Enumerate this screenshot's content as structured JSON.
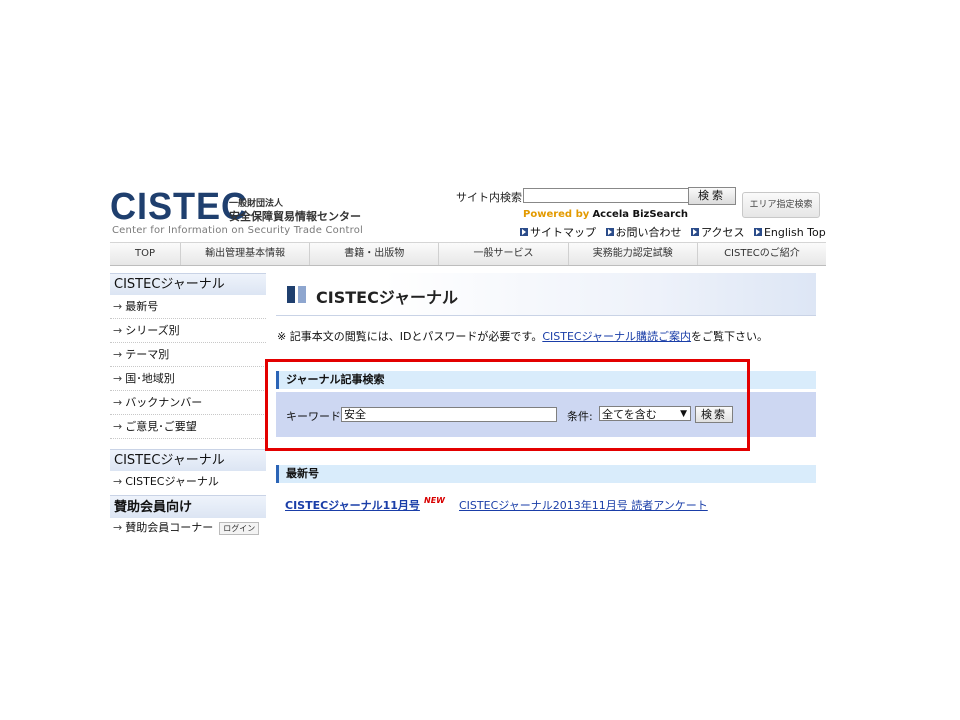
{
  "header": {
    "logo_text": "CISTEC",
    "org_line1": "一般財団法人",
    "org_line2": "安全保障貿易情報センター",
    "tagline": "Center for Information on Security Trade Control",
    "site_search_label": "サイト内検索",
    "site_search_value": "",
    "site_search_button": "検索",
    "area_search_button": "エリア指定検索",
    "powered_by": "Powered by",
    "powered_name": "Accela BizSearch",
    "util_links": [
      "サイトマップ",
      "お問い合わせ",
      "アクセス",
      "English Top"
    ]
  },
  "nav": [
    "TOP",
    "輸出管理基本情報",
    "書籍・出版物",
    "一般サービス",
    "実務能力認定試験",
    "CISTECのご紹介"
  ],
  "sidebar": {
    "journal_title": "CISTECジャーナル",
    "journal_items": [
      "最新号",
      "シリーズ別",
      "テーマ別",
      "国･地域別",
      "バックナンバー",
      "ご意見･ご要望"
    ],
    "journal2_title": "CISTECジャーナル",
    "journal2_items": [
      "CISTECジャーナル"
    ],
    "supporters_title": "賛助会員向け",
    "supporters_item": "賛助会員コーナー",
    "login_label": "ログイン"
  },
  "main": {
    "title": "CISTECジャーナル",
    "notice_prefix": "※ 記事本文の閲覧には、IDとパスワードが必要です。",
    "notice_link": "CISTECジャーナル購読ご案内",
    "notice_suffix": "をご覧下さい。",
    "search_section_title": "ジャーナル記事検索",
    "keyword_label": "キーワード",
    "keyword_value": "安全",
    "condition_label": "条件:",
    "condition_value": "全てを含む",
    "search_button": "検索",
    "latest_section_title": "最新号",
    "latest_issue": "CISTECジャーナル11月号",
    "new_badge": "NEW",
    "survey_link": "CISTECジャーナル2013年11月号 読者アンケート"
  },
  "colors": {
    "brand_navy": "#1f3f6e",
    "link_blue": "#1a3ea8",
    "section_bar": "#d9ecfb",
    "search_panel": "#cdd7f2",
    "highlight_red": "#e30000",
    "new_red": "#d80000"
  }
}
